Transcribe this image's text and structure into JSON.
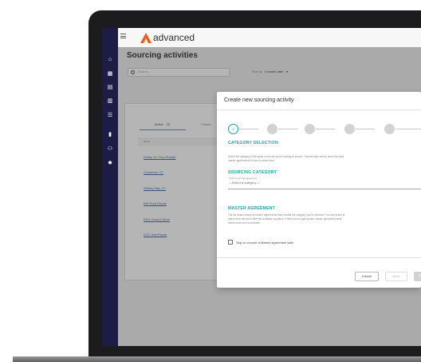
{
  "app": {
    "brand": "advanced",
    "page_title": "Sourcing activities"
  },
  "toolbar": {
    "search_placeholder": "Search...",
    "sort_label": "Sort by",
    "sort_value": "Created date ↓ ▾"
  },
  "tabs": [
    {
      "label": "Active",
      "count": "6"
    },
    {
      "label": "Closed"
    }
  ],
  "table": {
    "column_header": "Name",
    "rows": [
      "Kirkby CC Roof Repair",
      "Cockerton CC",
      "Whitley Bay CC",
      "BIS Roof Repair",
      "RSS Ground Work",
      "KCC Hall Repair"
    ]
  },
  "modal": {
    "title": "Create new sourcing activity",
    "step_current": "1",
    "category_selection": {
      "heading": "CATEGORY SELECTION",
      "text": "Select the category of the good or service you're looking to source. This will help narrow down the avail\nmaster agreements for you to select from."
    },
    "sourcing_category": {
      "heading": "SOURCING CATEGORY",
      "field_label": "List of sourcing categories",
      "value": "-- Select a category --"
    },
    "master_agreement": {
      "heading": "MASTER AGREEMENT",
      "text": "The list below shows all master agreements that provide the category you've selected. You can select ar\noption from this list to filter the available suppliers. If there are no appropriate master agreement avail\nselect below box to continue."
    },
    "skip_label": "Skip or choose a Master agreement later",
    "buttons": {
      "cancel": "Cancel",
      "back": "Back",
      "next": "Next"
    }
  },
  "colors": {
    "sidebar": "#1d1c47",
    "accent": "#22a0a2",
    "brand_orange": "#ef5a1d"
  },
  "icons": [
    "home-icon",
    "dashboard-icon",
    "document-icon",
    "briefcase-icon",
    "list-icon",
    "analytics-icon",
    "users-icon",
    "settings-icon",
    "menu-icon",
    "search-icon"
  ]
}
